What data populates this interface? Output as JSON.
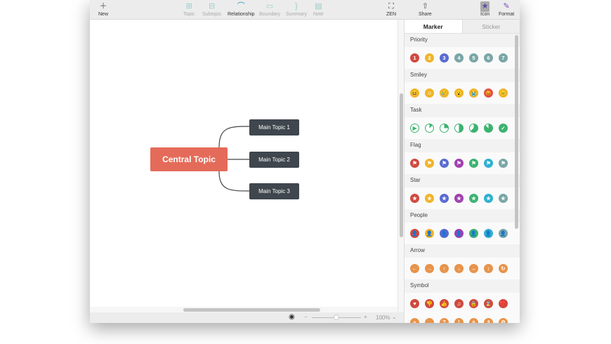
{
  "toolbar": {
    "new": "New",
    "topic": "Topic",
    "subtopic": "Subtopic",
    "relationship": "Relationship",
    "boundary": "Boundary",
    "summary": "Summary",
    "note": "Note",
    "zen": "ZEN",
    "share": "Share",
    "icon": "Icon",
    "format": "Format"
  },
  "map": {
    "central": "Central Topic",
    "topics": [
      "Main Topic 1",
      "Main Topic 2",
      "Main Topic 3"
    ],
    "central_color": "#e46b59",
    "topic_color": "#3f464d"
  },
  "status": {
    "zoom": "100%",
    "minus": "−",
    "plus": "+"
  },
  "panel": {
    "tabs": [
      "Marker",
      "Sticker"
    ],
    "sections": [
      {
        "title": "Priority",
        "rows": [
          [
            {
              "c": "#d0493f",
              "g": "1"
            },
            {
              "c": "#f0b429",
              "g": "2"
            },
            {
              "c": "#5a6bd0",
              "g": "3"
            },
            {
              "c": "#7aa6a6",
              "g": "4"
            },
            {
              "c": "#7aa6a6",
              "g": "5"
            },
            {
              "c": "#7aa6a6",
              "g": "6"
            },
            {
              "c": "#7aa6a6",
              "g": "7"
            }
          ]
        ]
      },
      {
        "title": "Smiley",
        "rows": [
          [
            {
              "c": "#f0b429",
              "g": "😆"
            },
            {
              "c": "#f0b429",
              "g": "☺"
            },
            {
              "c": "#f0b429",
              "g": "😢"
            },
            {
              "c": "#f0b429",
              "g": "😮"
            },
            {
              "c": "#f0b429",
              "g": "😭"
            },
            {
              "c": "#e0504a",
              "g": "😡"
            },
            {
              "c": "#f0b429",
              "g": "😐"
            }
          ]
        ]
      },
      {
        "title": "Task",
        "rows": [
          [
            {
              "c": "#3cb371",
              "g": "▶",
              "t": 0
            },
            {
              "c": "#3cb371",
              "g": "",
              "t": 0.125
            },
            {
              "c": "#3cb371",
              "g": "",
              "t": 0.25
            },
            {
              "c": "#3cb371",
              "g": "",
              "t": 0.5
            },
            {
              "c": "#3cb371",
              "g": "",
              "t": 0.625
            },
            {
              "c": "#3cb371",
              "g": "",
              "t": 0.875
            },
            {
              "c": "#3cb371",
              "g": "✓",
              "t": 1
            }
          ]
        ]
      },
      {
        "title": "Flag",
        "rows": [
          [
            {
              "c": "#d0493f",
              "g": "⚑"
            },
            {
              "c": "#f0b429",
              "g": "⚑"
            },
            {
              "c": "#5a6bd0",
              "g": "⚑"
            },
            {
              "c": "#a040b0",
              "g": "⚑"
            },
            {
              "c": "#3cb371",
              "g": "⚑"
            },
            {
              "c": "#2fb0d0",
              "g": "⚑"
            },
            {
              "c": "#7aa6a6",
              "g": "⚑"
            }
          ]
        ]
      },
      {
        "title": "Star",
        "rows": [
          [
            {
              "c": "#d0493f",
              "g": "★"
            },
            {
              "c": "#f0b429",
              "g": "★"
            },
            {
              "c": "#5a6bd0",
              "g": "★"
            },
            {
              "c": "#a040b0",
              "g": "★"
            },
            {
              "c": "#3cb371",
              "g": "★"
            },
            {
              "c": "#2fb0d0",
              "g": "★"
            },
            {
              "c": "#7aa6a6",
              "g": "★"
            }
          ]
        ]
      },
      {
        "title": "People",
        "rows": [
          [
            {
              "c": "#d0493f",
              "g": "👤"
            },
            {
              "c": "#f0b429",
              "g": "👤"
            },
            {
              "c": "#5a6bd0",
              "g": "👤"
            },
            {
              "c": "#a040b0",
              "g": "👤"
            },
            {
              "c": "#3cb371",
              "g": "👤"
            },
            {
              "c": "#2fb0d0",
              "g": "👤"
            },
            {
              "c": "#7aa6a6",
              "g": "👤"
            }
          ]
        ]
      },
      {
        "title": "Arrow",
        "rows": [
          [
            {
              "c": "#e8934a",
              "g": "←"
            },
            {
              "c": "#e8934a",
              "g": "→"
            },
            {
              "c": "#e8934a",
              "g": "↑"
            },
            {
              "c": "#e8934a",
              "g": "↓"
            },
            {
              "c": "#e8934a",
              "g": "↔"
            },
            {
              "c": "#e8934a",
              "g": "↕"
            },
            {
              "c": "#e8934a",
              "g": "↻"
            }
          ]
        ]
      },
      {
        "title": "Symbol",
        "rows": [
          [
            {
              "c": "#d0493f",
              "g": "♥"
            },
            {
              "c": "#d0493f",
              "g": "👎"
            },
            {
              "c": "#d0493f",
              "g": "👍"
            },
            {
              "c": "#d0493f",
              "g": "♫"
            },
            {
              "c": "#d0493f",
              "g": "🔒"
            },
            {
              "c": "#d0493f",
              "g": "⌛"
            },
            {
              "c": "#d0493f",
              "g": "💔"
            }
          ],
          [
            {
              "c": "#e8934a",
              "g": "«"
            },
            {
              "c": "#e8934a",
              "g": "…"
            },
            {
              "c": "#e8934a",
              "g": "?"
            },
            {
              "c": "#e8934a",
              "g": "!"
            },
            {
              "c": "#e8934a",
              "g": "×"
            },
            {
              "c": "#e8934a",
              "g": "॥"
            },
            {
              "c": "#e8934a",
              "g": "⊘"
            }
          ]
        ]
      }
    ]
  }
}
